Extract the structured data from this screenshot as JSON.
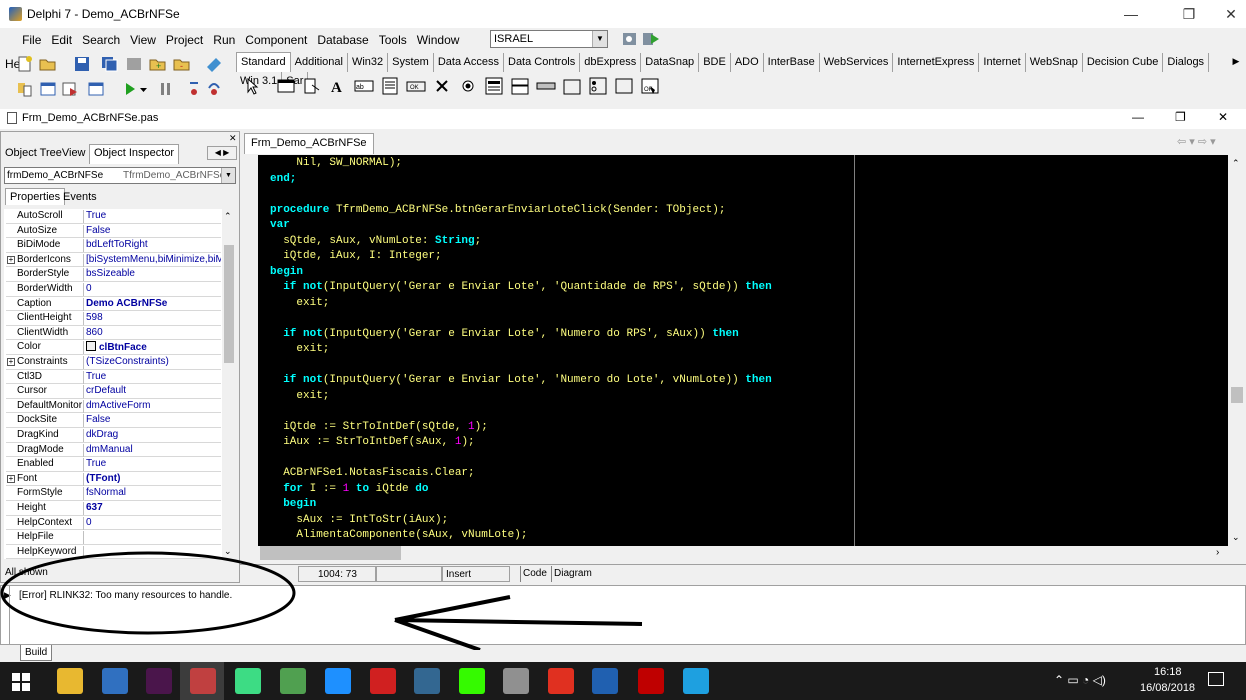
{
  "window": {
    "title": "Delphi 7 - Demo_ACBrNFSe",
    "controls": {
      "minimize": "—",
      "restore": "❐",
      "close": "✕"
    }
  },
  "menu": [
    "File",
    "Edit",
    "Search",
    "View",
    "Project",
    "Run",
    "Component",
    "Database",
    "Tools",
    "Window",
    "Help"
  ],
  "desktop_combo": {
    "value": "ISRAEL"
  },
  "palette_tabs": [
    "Standard",
    "Additional",
    "Win32",
    "System",
    "Data Access",
    "Data Controls",
    "dbExpress",
    "DataSnap",
    "BDE",
    "ADO",
    "InterBase",
    "WebServices",
    "InternetExpress",
    "Internet",
    "WebSnap",
    "Decision Cube",
    "Dialogs",
    "Win 3.1",
    "Sar"
  ],
  "editor": {
    "file_title": "Frm_Demo_ACBrNFSe.pas",
    "tab": "Frm_Demo_ACBrNFSe",
    "status": {
      "position": "1004:  73",
      "mode": "Insert",
      "tab_code": "Code",
      "tab_diagram": "Diagram"
    }
  },
  "object_inspector": {
    "tabs": [
      "Object TreeView",
      "Object Inspector"
    ],
    "selected_component": "frmDemo_ACBrNFSe",
    "selected_type": "TfrmDemo_ACBrNFSe",
    "subtabs": [
      "Properties",
      "Events"
    ],
    "status": "All shown",
    "properties": [
      {
        "name": "AutoScroll",
        "value": "True"
      },
      {
        "name": "AutoSize",
        "value": "False"
      },
      {
        "name": "BiDiMode",
        "value": "bdLeftToRight"
      },
      {
        "name": "BorderIcons",
        "value": "[biSystemMenu,biMinimize,biMa",
        "expand": "+"
      },
      {
        "name": "BorderStyle",
        "value": "bsSizeable"
      },
      {
        "name": "BorderWidth",
        "value": "0"
      },
      {
        "name": "Caption",
        "value": "Demo ACBrNFSe",
        "bold": true
      },
      {
        "name": "ClientHeight",
        "value": "598"
      },
      {
        "name": "ClientWidth",
        "value": "860"
      },
      {
        "name": "Color",
        "value": "clBtnFace",
        "bold": true
      },
      {
        "name": "Constraints",
        "value": "(TSizeConstraints)",
        "expand": "+"
      },
      {
        "name": "Ctl3D",
        "value": "True"
      },
      {
        "name": "Cursor",
        "value": "crDefault"
      },
      {
        "name": "DefaultMonitor",
        "value": "dmActiveForm"
      },
      {
        "name": "DockSite",
        "value": "False"
      },
      {
        "name": "DragKind",
        "value": "dkDrag"
      },
      {
        "name": "DragMode",
        "value": "dmManual"
      },
      {
        "name": "Enabled",
        "value": "True"
      },
      {
        "name": "Font",
        "value": "(TFont)",
        "bold": true,
        "expand": "+"
      },
      {
        "name": "FormStyle",
        "value": "fsNormal"
      },
      {
        "name": "Height",
        "value": "637",
        "bold": true
      },
      {
        "name": "HelpContext",
        "value": "0"
      },
      {
        "name": "HelpFile",
        "value": ""
      },
      {
        "name": "HelpKeyword",
        "value": ""
      }
    ]
  },
  "code_lines": [
    [
      [
        "    Nil, SW_NORMAL);",
        ""
      ]
    ],
    [
      [
        "end;",
        "kw"
      ]
    ],
    [
      [
        "",
        ""
      ]
    ],
    [
      [
        "procedure",
        "kw"
      ],
      [
        " TfrmDemo_ACBrNFSe.btnGerarEnviarLoteClick(Sender: TObject);",
        ""
      ]
    ],
    [
      [
        "var",
        "kw"
      ]
    ],
    [
      [
        "  sQtde, sAux, vNumLote: ",
        ""
      ],
      [
        "String",
        "kw"
      ],
      [
        ";",
        ""
      ]
    ],
    [
      [
        "  iQtde, iAux, I: Integer;",
        ""
      ]
    ],
    [
      [
        "begin",
        "kw"
      ]
    ],
    [
      [
        "  ",
        ""
      ],
      [
        "if not",
        "kw"
      ],
      [
        "(InputQuery(",
        ""
      ],
      [
        "'Gerar e Enviar Lote'",
        "str"
      ],
      [
        ", ",
        ""
      ],
      [
        "'Quantidade de RPS'",
        "str"
      ],
      [
        ", sQtde)) ",
        ""
      ],
      [
        "then",
        "kw"
      ]
    ],
    [
      [
        "    exit;",
        ""
      ]
    ],
    [
      [
        "",
        ""
      ]
    ],
    [
      [
        "  ",
        ""
      ],
      [
        "if not",
        "kw"
      ],
      [
        "(InputQuery(",
        ""
      ],
      [
        "'Gerar e Enviar Lote'",
        "str"
      ],
      [
        ", ",
        ""
      ],
      [
        "'Numero do RPS'",
        "str"
      ],
      [
        ", sAux)) ",
        ""
      ],
      [
        "then",
        "kw"
      ]
    ],
    [
      [
        "    exit;",
        ""
      ]
    ],
    [
      [
        "",
        ""
      ]
    ],
    [
      [
        "  ",
        ""
      ],
      [
        "if not",
        "kw"
      ],
      [
        "(InputQuery(",
        ""
      ],
      [
        "'Gerar e Enviar Lote'",
        "str"
      ],
      [
        ", ",
        ""
      ],
      [
        "'Numero do Lote'",
        "str"
      ],
      [
        ", vNumLote)) ",
        ""
      ],
      [
        "then",
        "kw"
      ]
    ],
    [
      [
        "    exit;",
        ""
      ]
    ],
    [
      [
        "",
        ""
      ]
    ],
    [
      [
        "  iQtde := StrToIntDef(sQtde, ",
        ""
      ],
      [
        "1",
        "num"
      ],
      [
        ");",
        ""
      ]
    ],
    [
      [
        "  iAux := StrToIntDef(sAux, ",
        ""
      ],
      [
        "1",
        "num"
      ],
      [
        ");",
        ""
      ]
    ],
    [
      [
        "",
        ""
      ]
    ],
    [
      [
        "  ACBrNFSe1.NotasFiscais.Clear;",
        ""
      ]
    ],
    [
      [
        "  ",
        ""
      ],
      [
        "for",
        "kw"
      ],
      [
        " I := ",
        ""
      ],
      [
        "1",
        "num"
      ],
      [
        " ",
        ""
      ],
      [
        "to",
        "kw"
      ],
      [
        " iQtde ",
        ""
      ],
      [
        "do",
        "kw"
      ]
    ],
    [
      [
        "  ",
        ""
      ],
      [
        "begin",
        "kw"
      ]
    ],
    [
      [
        "    sAux := IntToStr(iAux);",
        ""
      ]
    ],
    [
      [
        "    AlimentaComponente(sAux, vNumLote);",
        ""
      ]
    ]
  ],
  "messages": {
    "error": "[Error] RLINK32: Too many resources to handle.",
    "tab": "Build"
  },
  "taskbar": {
    "time": "16:18",
    "date": "16/08/2018",
    "apps": [
      "windows-start",
      "file-explorer",
      "server-manager",
      "slack",
      "delphi7",
      "android-studio",
      "tortoise",
      "edge",
      "dx",
      "pgadmin",
      "dreamweaver",
      "database",
      "ms-office",
      "virtualbox",
      "filezilla",
      "internet-explorer"
    ]
  }
}
